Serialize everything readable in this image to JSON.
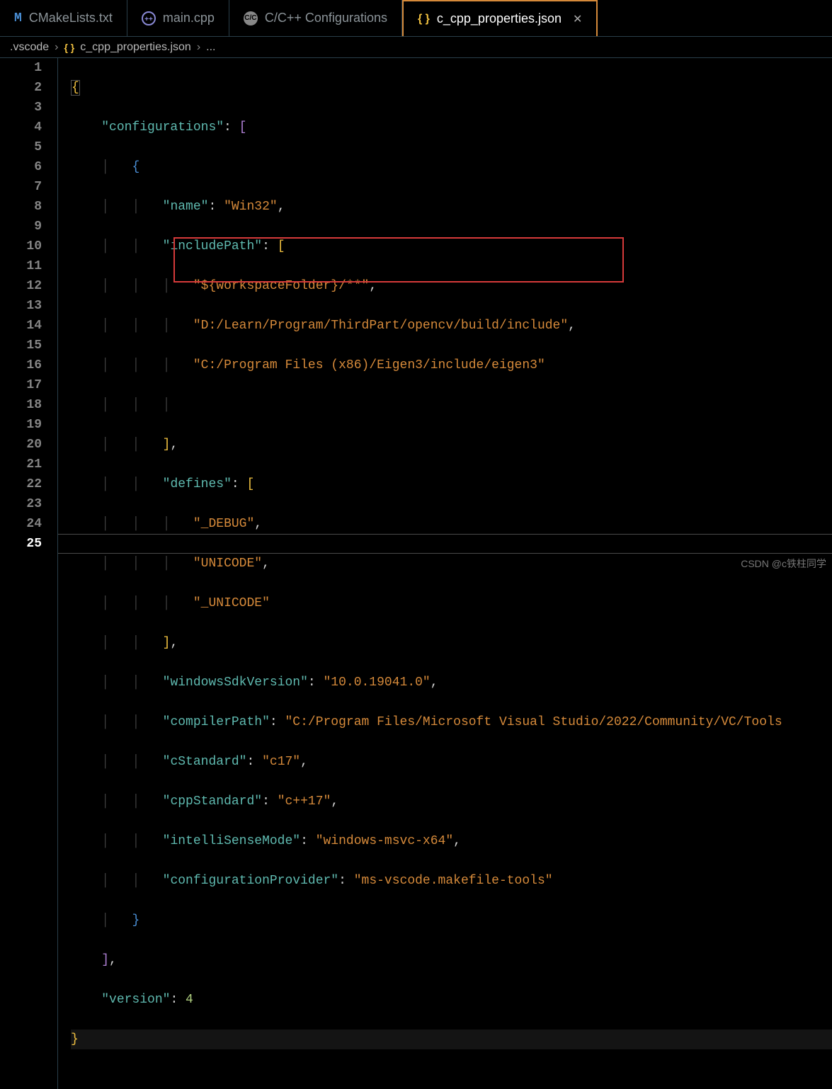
{
  "tabs": [
    {
      "icon": "M",
      "label": "CMakeLists.txt"
    },
    {
      "icon": "C++",
      "label": "main.cpp"
    },
    {
      "icon": "cfg",
      "label": "C/C++ Configurations"
    },
    {
      "icon": "{}",
      "label": "c_cpp_properties.json",
      "active": true
    }
  ],
  "breadcrumb": {
    "folder": ".vscode",
    "file": "c_cpp_properties.json",
    "tail": "..."
  },
  "line_numbers": [
    "1",
    "2",
    "3",
    "4",
    "5",
    "6",
    "7",
    "8",
    "9",
    "10",
    "11",
    "12",
    "13",
    "14",
    "15",
    "16",
    "17",
    "18",
    "19",
    "20",
    "21",
    "22",
    "23",
    "24",
    "25"
  ],
  "current_line": 25,
  "code": {
    "keys": {
      "configurations": "\"configurations\"",
      "name": "\"name\"",
      "includePath": "\"includePath\"",
      "defines": "\"defines\"",
      "windowsSdkVersion": "\"windowsSdkVersion\"",
      "compilerPath": "\"compilerPath\"",
      "cStandard": "\"cStandard\"",
      "cppStandard": "\"cppStandard\"",
      "intelliSenseMode": "\"intelliSenseMode\"",
      "configurationProvider": "\"configurationProvider\"",
      "version": "\"version\""
    },
    "vals": {
      "name": "\"Win32\"",
      "inc1": "\"${workspaceFolder}/**\"",
      "inc2": "\"D:/Learn/Program/ThirdPart/opencv/build/include\"",
      "inc3": "\"C:/Program Files (x86)/Eigen3/include/eigen3\"",
      "def1": "\"_DEBUG\"",
      "def2": "\"UNICODE\"",
      "def3": "\"_UNICODE\"",
      "sdk": "\"10.0.19041.0\"",
      "compiler": "\"C:/Program Files/Microsoft Visual Studio/2022/Community/VC/Tools",
      "cStd": "\"c17\"",
      "cppStd": "\"c++17\"",
      "isMode": "\"windows-msvc-x64\"",
      "cfgProv": "\"ms-vscode.makefile-tools\"",
      "version": "4"
    }
  },
  "watermark": "CSDN @c铁柱同学"
}
